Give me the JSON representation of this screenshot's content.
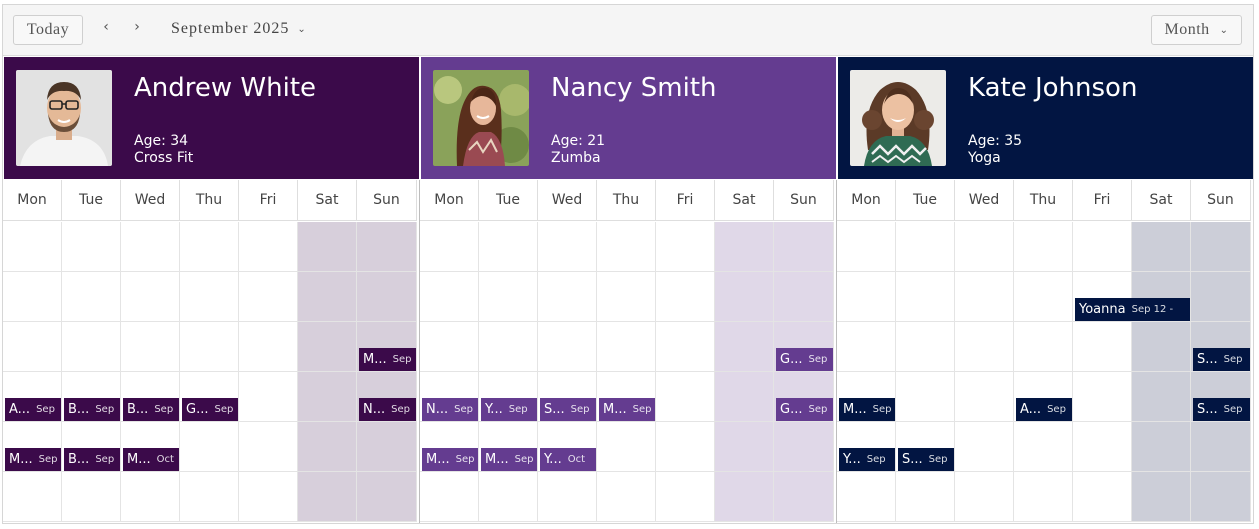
{
  "toolbar": {
    "today_label": "Today",
    "prev_icon": "‹",
    "next_icon": "›",
    "period_label": "September 2025",
    "view_label": "Month",
    "dropdown_icon": "⌄"
  },
  "resources": [
    {
      "name": "Andrew White",
      "age": "Age: 34",
      "activity": "Cross Fit",
      "color": "#3b0a4a",
      "weekend_color": "#d7cfdb"
    },
    {
      "name": "Nancy Smith",
      "age": "Age: 21",
      "activity": "Zumba",
      "color": "#643c90",
      "weekend_color": "#e0d8e8"
    },
    {
      "name": "Kate Johnson",
      "age": "Age: 35",
      "activity": "Yoga",
      "color": "#021542",
      "weekend_color": "#ccced8"
    }
  ],
  "days": [
    "Mon",
    "Tue",
    "Wed",
    "Thu",
    "Fri",
    "Sat",
    "Sun"
  ],
  "events": [
    {
      "res": 0,
      "day": 6,
      "row": 2,
      "title": "M...",
      "date": "Sep"
    },
    {
      "res": 0,
      "day": 0,
      "row": 3,
      "title": "A...",
      "date": "Sep"
    },
    {
      "res": 0,
      "day": 1,
      "row": 3,
      "title": "B...",
      "date": "Sep"
    },
    {
      "res": 0,
      "day": 2,
      "row": 3,
      "title": "B...",
      "date": "Sep"
    },
    {
      "res": 0,
      "day": 3,
      "row": 3,
      "title": "G...",
      "date": "Sep"
    },
    {
      "res": 0,
      "day": 6,
      "row": 3,
      "title": "N...",
      "date": "Sep"
    },
    {
      "res": 0,
      "day": 0,
      "row": 4,
      "title": "M...",
      "date": "Sep"
    },
    {
      "res": 0,
      "day": 1,
      "row": 4,
      "title": "B...",
      "date": "Sep"
    },
    {
      "res": 0,
      "day": 2,
      "row": 4,
      "title": "M...",
      "date": "Oct"
    },
    {
      "res": 1,
      "day": 6,
      "row": 2,
      "title": "G...",
      "date": "Sep"
    },
    {
      "res": 1,
      "day": 0,
      "row": 3,
      "title": "N...",
      "date": "Sep"
    },
    {
      "res": 1,
      "day": 1,
      "row": 3,
      "title": "Y...",
      "date": "Sep"
    },
    {
      "res": 1,
      "day": 2,
      "row": 3,
      "title": "S...",
      "date": "Sep"
    },
    {
      "res": 1,
      "day": 3,
      "row": 3,
      "title": "M...",
      "date": "Sep"
    },
    {
      "res": 1,
      "day": 6,
      "row": 3,
      "title": "G...",
      "date": "Sep"
    },
    {
      "res": 1,
      "day": 0,
      "row": 4,
      "title": "M...",
      "date": "Sep"
    },
    {
      "res": 1,
      "day": 1,
      "row": 4,
      "title": "M...",
      "date": "Sep"
    },
    {
      "res": 1,
      "day": 2,
      "row": 4,
      "title": "Y...",
      "date": "Oct"
    },
    {
      "res": 2,
      "day": 4,
      "row": 1,
      "title": "Yoanna",
      "date": "Sep 12 -",
      "span": 2
    },
    {
      "res": 2,
      "day": 6,
      "row": 2,
      "title": "S...",
      "date": "Sep"
    },
    {
      "res": 2,
      "day": 0,
      "row": 3,
      "title": "M...",
      "date": "Sep"
    },
    {
      "res": 2,
      "day": 3,
      "row": 3,
      "title": "A...",
      "date": "Sep"
    },
    {
      "res": 2,
      "day": 6,
      "row": 3,
      "title": "S...",
      "date": "Sep"
    },
    {
      "res": 2,
      "day": 0,
      "row": 4,
      "title": "Y...",
      "date": "Sep"
    },
    {
      "res": 2,
      "day": 1,
      "row": 4,
      "title": "S...",
      "date": "Sep"
    }
  ]
}
